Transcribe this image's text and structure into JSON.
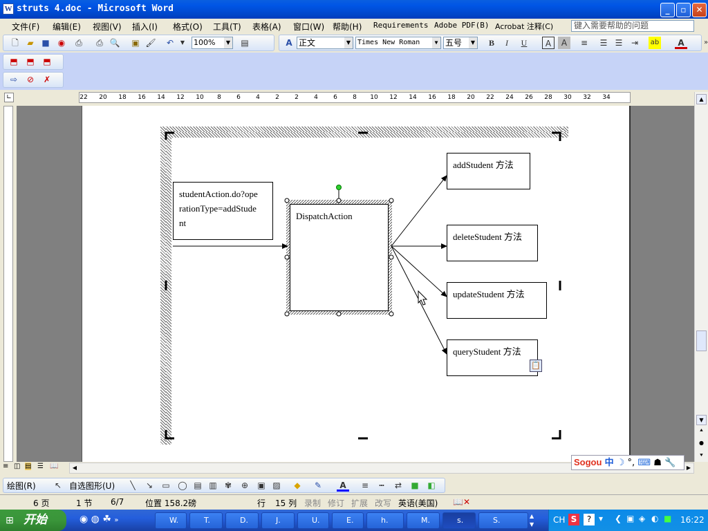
{
  "window": {
    "title": "struts 4.doc - Microsoft Word",
    "app_icon": "W"
  },
  "menus": [
    "文件(F)",
    "编辑(E)",
    "视图(V)",
    "插入(I)",
    "格式(O)",
    "工具(T)",
    "表格(A)",
    "窗口(W)",
    "帮助(H)",
    "Requirements",
    "Adobe PDF(B)",
    "Acrobat 注释(C)"
  ],
  "help_box": {
    "placeholder": "键入需要帮助的问题"
  },
  "toolbar": {
    "zoom": "100%",
    "style": "正文",
    "font": "Times New Roman",
    "size": "五号"
  },
  "ruler": {
    "labels": [
      "22",
      "20",
      "18",
      "16",
      "14",
      "12",
      "10",
      "8",
      "6",
      "4",
      "2",
      "2",
      "4",
      "6",
      "8",
      "10",
      "12",
      "14",
      "16",
      "18",
      "20",
      "22",
      "24",
      "26",
      "28",
      "30",
      "32",
      "34"
    ]
  },
  "diagram": {
    "source": "studentAction.do?operationType=addStudent",
    "source_lines": [
      "studentAction.do?ope",
      "rationType=addStude",
      "nt"
    ],
    "center": "DispatchAction",
    "targets": [
      "addStudent 方法",
      "deleteStudent 方法",
      "updateStudent 方法",
      "queryStudent 方法"
    ]
  },
  "drawing_toolbar": {
    "draw": "绘图(R)",
    "autoshapes": "自选图形(U)"
  },
  "status": {
    "page": "6 页",
    "section": "1 节",
    "pages": "6/7",
    "position": "位置 158.2磅",
    "line": "行",
    "col": "15 列",
    "rec": "录制",
    "trk": "修订",
    "ext": "扩展",
    "ovr": "改写",
    "lang": "英语(美国)"
  },
  "taskbar": {
    "start": "开始",
    "tasks": [
      "W.",
      "T.",
      "D.",
      "J.",
      "U.",
      "E.",
      "h.",
      "M.",
      "s.",
      "S."
    ],
    "clock": "16:22",
    "ime": "CH"
  }
}
